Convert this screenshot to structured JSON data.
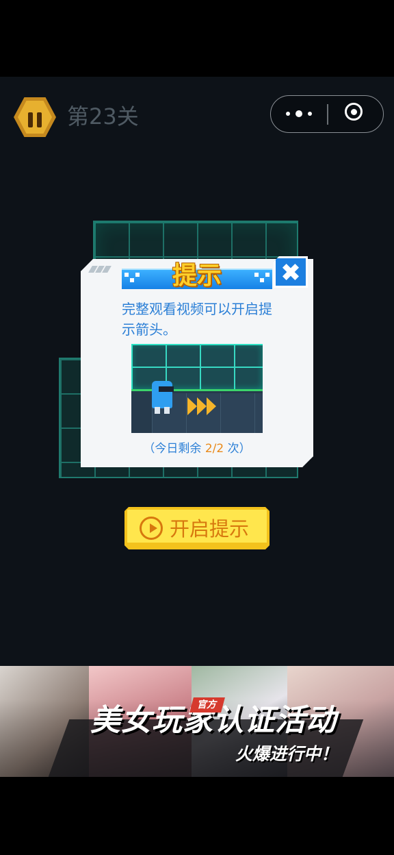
{
  "header": {
    "level_title": "第23关"
  },
  "dialog": {
    "title": "提示",
    "description": "完整观看视频可以开启提示箭头。",
    "remaining_prefix": "（今日剩余 ",
    "remaining_count": "2/2",
    "remaining_suffix": " 次）"
  },
  "hint_button": {
    "label": "开启提示"
  },
  "banner": {
    "tag": "官方",
    "title": "美女玩家认证活动",
    "subtitle": "火爆进行中！"
  },
  "colors": {
    "accent_blue": "#2b7fd6",
    "button_yellow": "#ffe64d",
    "button_text": "#d7780e",
    "grid_line": "#1e6f66"
  },
  "icons": [
    "pause-icon",
    "more-icon",
    "mini-program-close-icon",
    "close-icon",
    "play-icon",
    "robot-sprite",
    "direction-arrow-icon"
  ]
}
